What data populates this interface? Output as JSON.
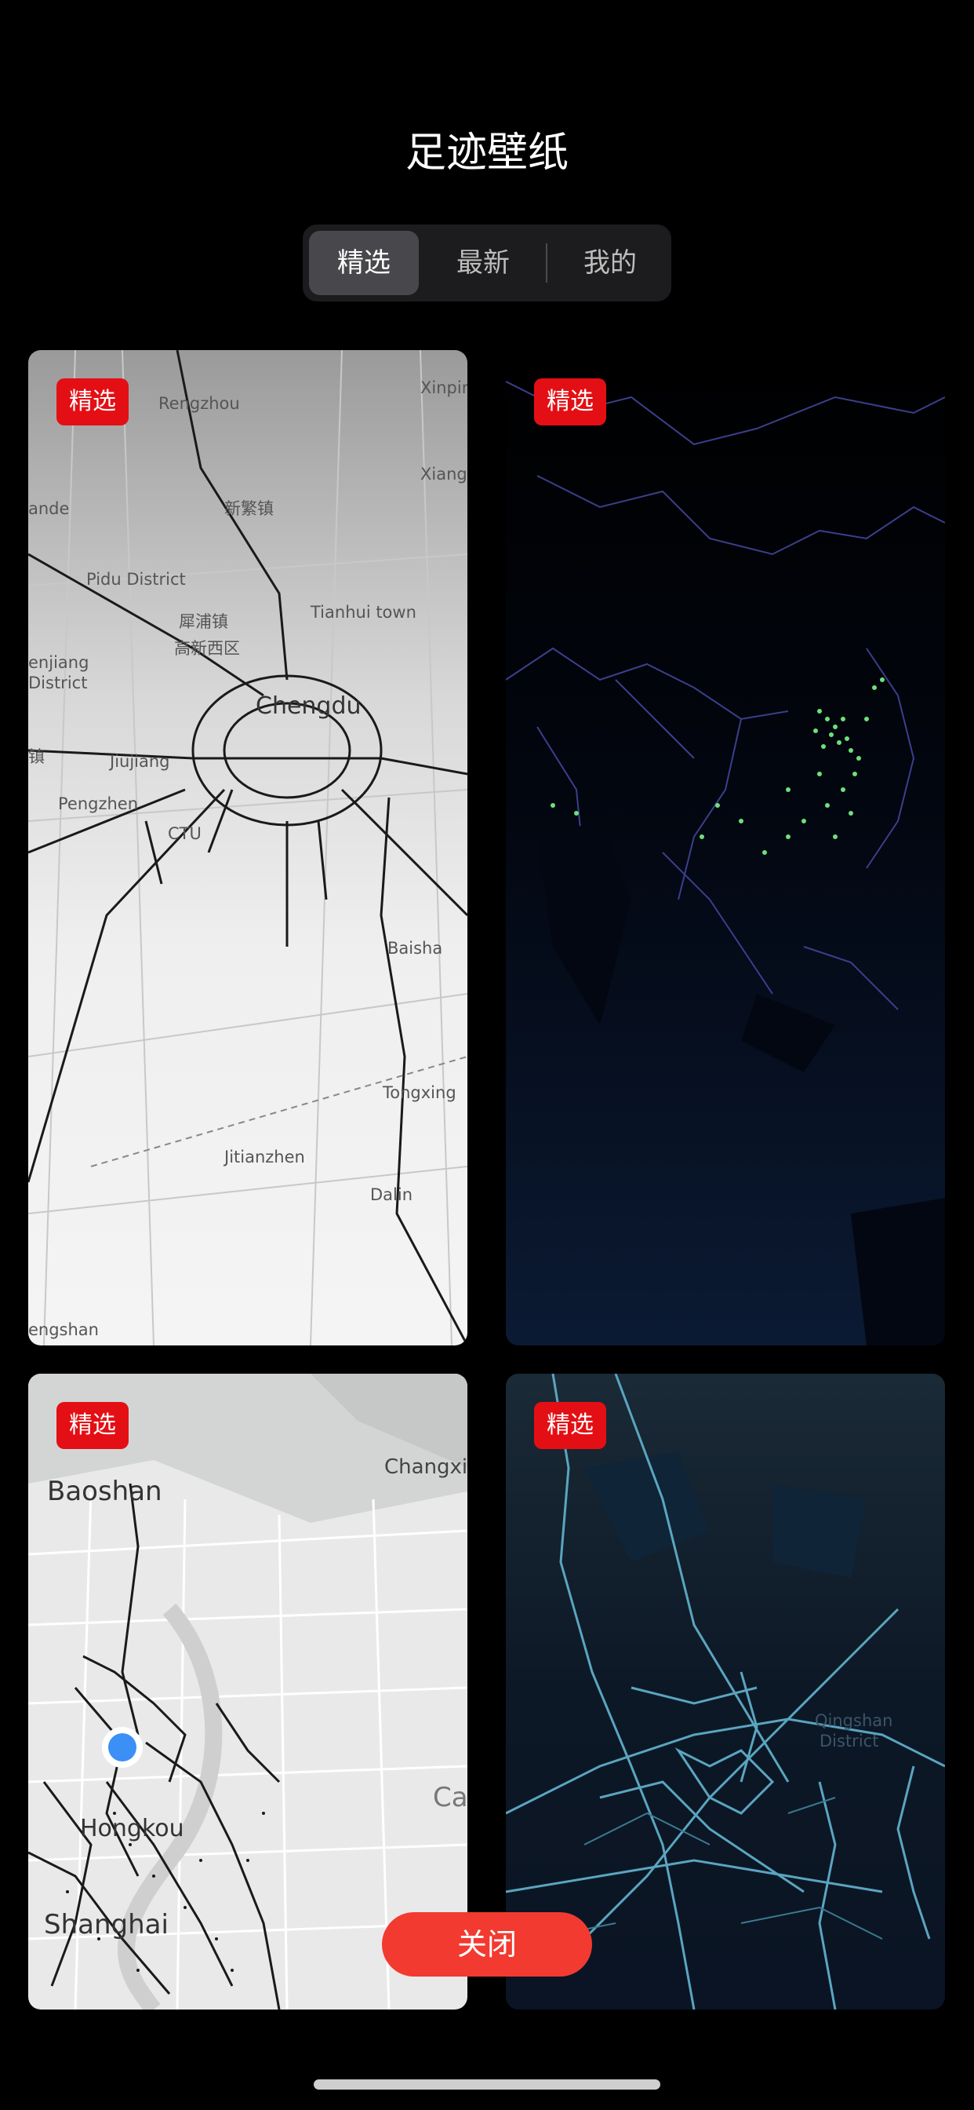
{
  "title": "足迹壁纸",
  "tabs": [
    {
      "label": "精选",
      "active": true
    },
    {
      "label": "最新",
      "active": false
    },
    {
      "label": "我的",
      "active": false
    }
  ],
  "cards": [
    {
      "badge": "精选",
      "theme": "light-gray",
      "labels": [
        "Rengzhou",
        "Xinpin",
        "Xiangy",
        "新繁镇",
        "ande",
        "Pidu District",
        "犀浦镇",
        "Tianhui town",
        "高新西区",
        "Chengdu",
        "enjiang",
        "District",
        "Jiujiang",
        "Pengzhen",
        "Baisha",
        "Tongxing",
        "Jitianzhen",
        "Dalin",
        "engshan",
        "镇",
        "CTU"
      ]
    },
    {
      "badge": "精选",
      "theme": "dark-navy"
    },
    {
      "badge": "精选",
      "theme": "light-gray",
      "labels": [
        "Baoshan",
        "Changxi",
        "Hongkou",
        "Shanghai",
        "Ca"
      ]
    },
    {
      "badge": "精选",
      "theme": "dark-teal",
      "labels": [
        "Qingshan",
        "District"
      ]
    }
  ],
  "close_button": "关闭",
  "colors": {
    "badge": "#e40f14",
    "close_button": "#f23a30",
    "track_green": "#6ee07a",
    "location_dot": "#3b8ff5"
  }
}
